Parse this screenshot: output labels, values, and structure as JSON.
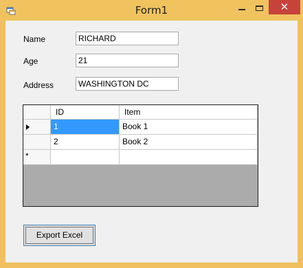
{
  "window": {
    "title": "Form1",
    "close_glyph": "✕"
  },
  "form": {
    "name_label": "Name",
    "name_value": "RICHARD",
    "age_label": "Age",
    "age_value": "21",
    "address_label": "Address",
    "address_value": "WASHINGTON DC"
  },
  "grid": {
    "columns": [
      "ID",
      "Item"
    ],
    "rows": [
      {
        "id": "1",
        "item": "Book 1"
      },
      {
        "id": "2",
        "item": "Book 2"
      }
    ],
    "new_row_marker": "*"
  },
  "actions": {
    "export_label": "Export Excel"
  },
  "colors": {
    "frame": "#f0c35e",
    "close_button": "#c7423b",
    "selection": "#3399ff"
  }
}
